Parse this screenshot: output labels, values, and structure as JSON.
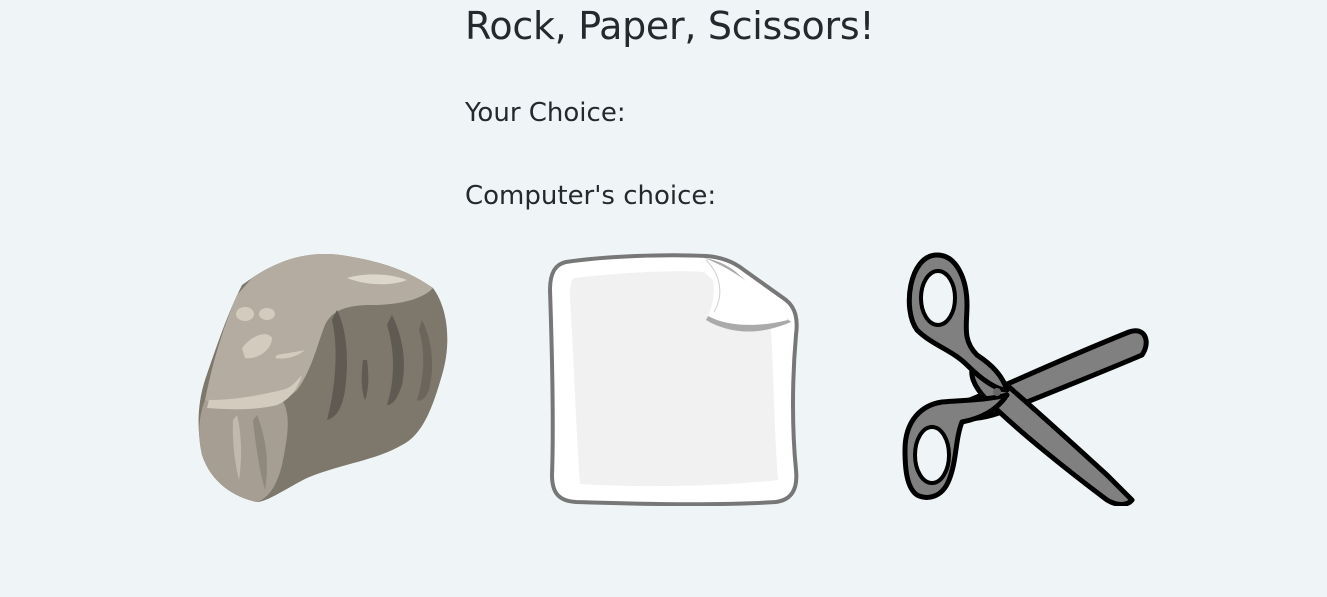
{
  "game": {
    "title": "Rock, Paper, Scissors!",
    "your_choice_label": "Your Choice:",
    "your_choice_value": "",
    "computer_choice_label": "Computer's choice:",
    "computer_choice_value": ""
  },
  "options": [
    {
      "name": "rock",
      "icon": "rock-icon"
    },
    {
      "name": "paper",
      "icon": "paper-icon"
    },
    {
      "name": "scissors",
      "icon": "scissors-icon"
    }
  ],
  "colors": {
    "background": "#eff5f6",
    "text": "#24292e",
    "rock_light": "#b4aca0",
    "rock_dark": "#7d776c",
    "paper_fill": "#f2f1f2",
    "paper_border": "#777777",
    "scissors_fill": "#808080"
  }
}
